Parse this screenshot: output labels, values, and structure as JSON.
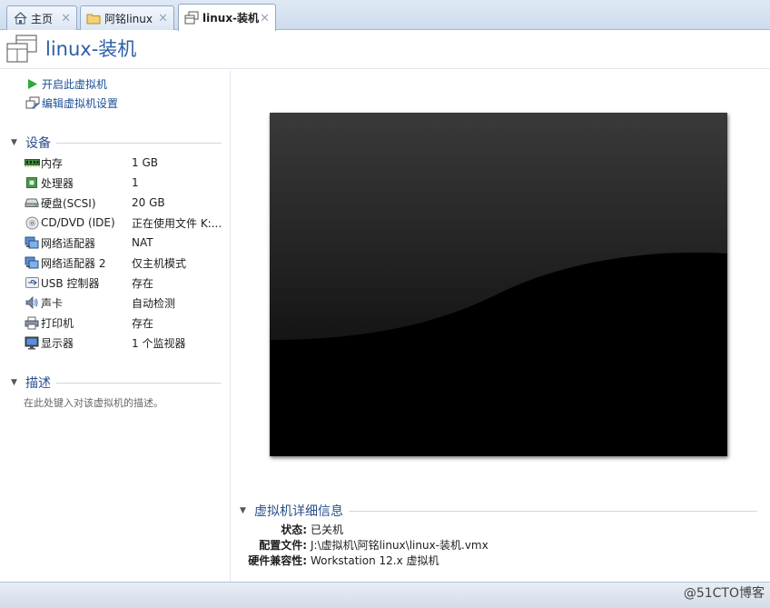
{
  "tabs": [
    {
      "label": "主页",
      "icon": "home-icon"
    },
    {
      "label": "阿铭linux",
      "icon": "folder-icon"
    },
    {
      "label": "linux-装机",
      "icon": "vm-icon",
      "active": true
    }
  ],
  "tab_close_glyph": "×",
  "header": {
    "title": "linux-装机"
  },
  "actions": {
    "power_on": "开启此虚拟机",
    "edit_settings": "编辑虚拟机设置"
  },
  "devices": {
    "section_title": "设备",
    "items": [
      {
        "name": "内存",
        "value": "1 GB",
        "icon": "memory-icon"
      },
      {
        "name": "处理器",
        "value": "1",
        "icon": "cpu-icon"
      },
      {
        "name": "硬盘(SCSI)",
        "value": "20 GB",
        "icon": "harddisk-icon"
      },
      {
        "name": "CD/DVD (IDE)",
        "value": "正在使用文件 K:...",
        "icon": "cdrom-icon"
      },
      {
        "name": "网络适配器",
        "value": "NAT",
        "icon": "network-icon"
      },
      {
        "name": "网络适配器 2",
        "value": "仅主机模式",
        "icon": "network-icon"
      },
      {
        "name": "USB 控制器",
        "value": "存在",
        "icon": "usb-icon"
      },
      {
        "name": "声卡",
        "value": "自动检测",
        "icon": "sound-icon"
      },
      {
        "name": "打印机",
        "value": "存在",
        "icon": "printer-icon"
      },
      {
        "name": "显示器",
        "value": "1 个监视器",
        "icon": "monitor-icon"
      }
    ]
  },
  "description": {
    "section_title": "描述",
    "placeholder": "在此处键入对该虚拟机的描述。"
  },
  "details": {
    "section_title": "虚拟机详细信息",
    "rows": [
      {
        "key": "状态:",
        "value": "已关机"
      },
      {
        "key": "配置文件:",
        "value": "J:\\虚拟机\\阿铭linux\\linux-装机.vmx"
      },
      {
        "key": "硬件兼容性:",
        "value": "Workstation 12.x 虚拟机"
      }
    ]
  },
  "watermark": "@51CTO博客",
  "colors": {
    "link": "#1a4f96",
    "title": "#2a5ea8",
    "section": "#2a4f8a",
    "play": "#2fa83a"
  }
}
